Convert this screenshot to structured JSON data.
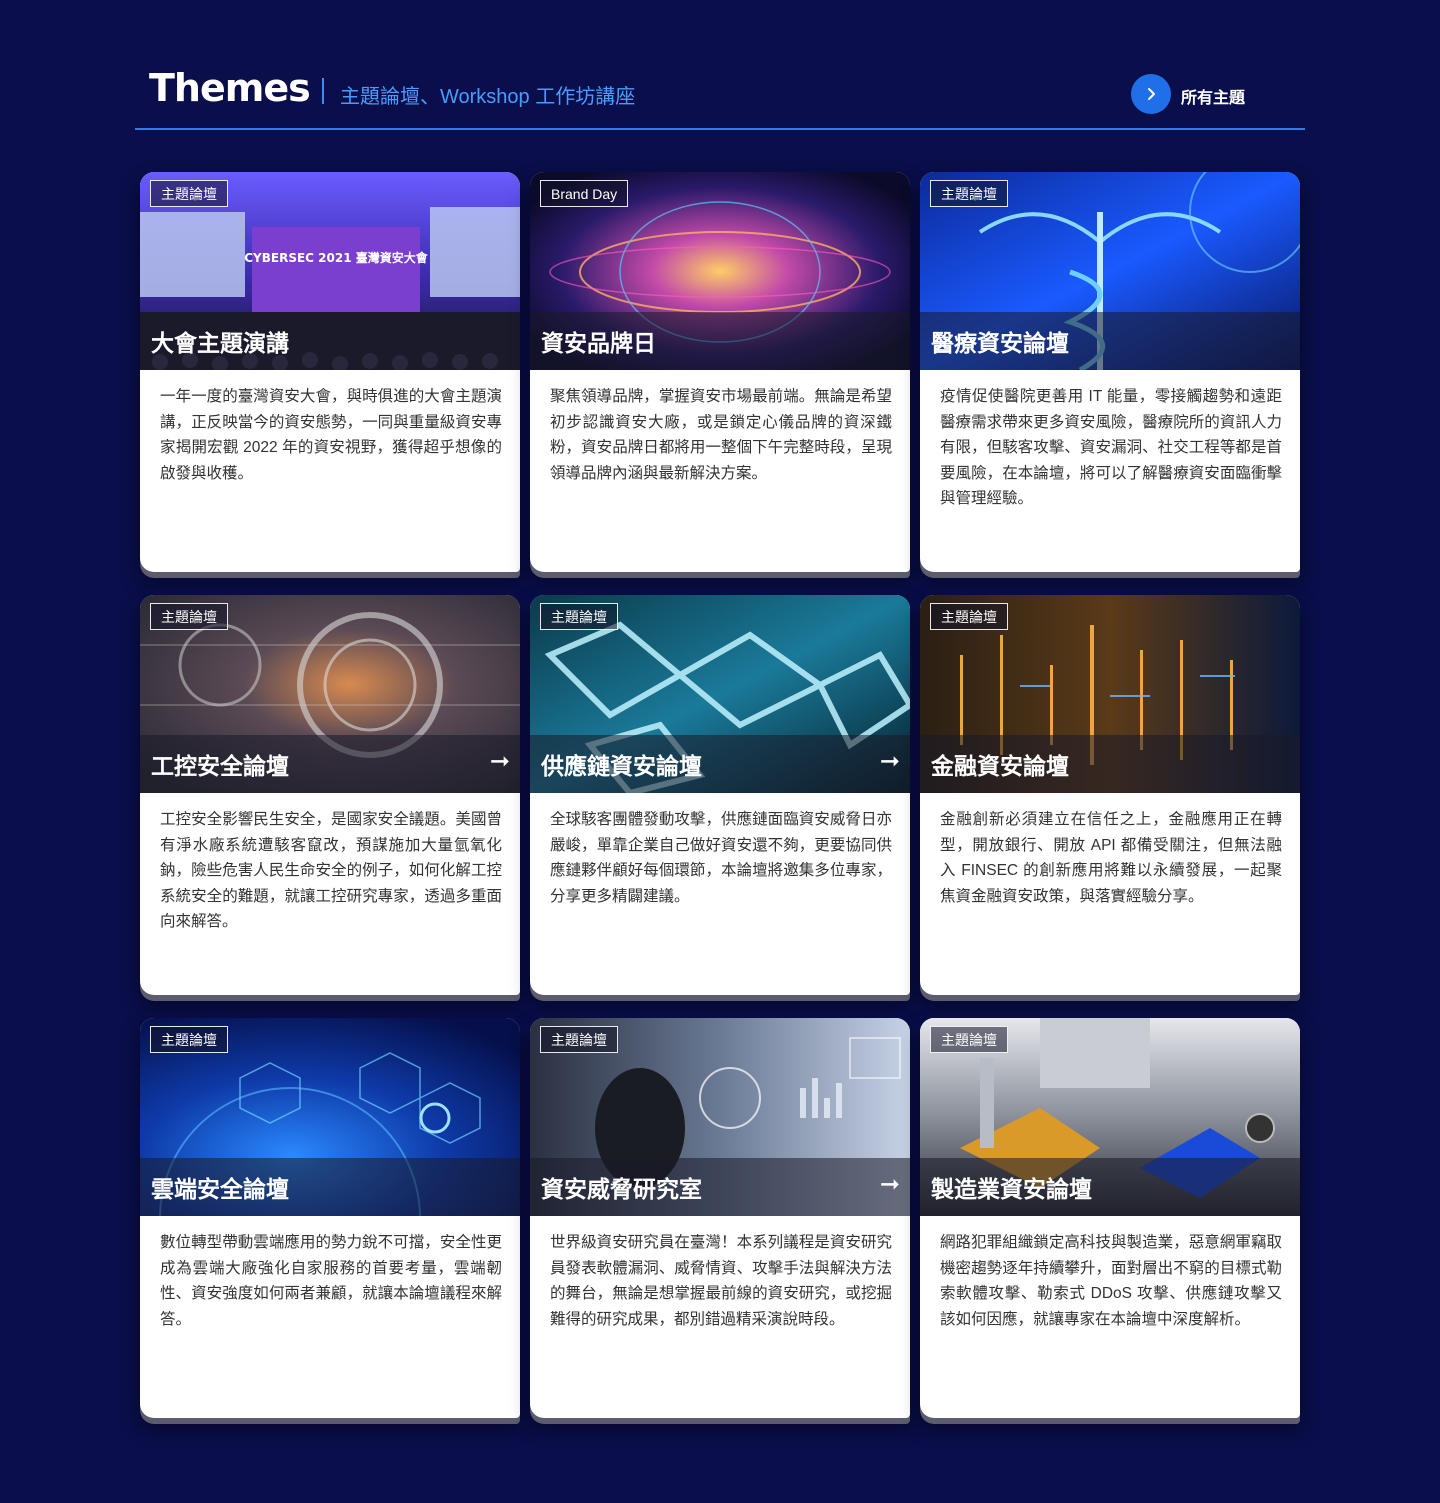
{
  "header": {
    "title": "Themes",
    "subtitle": "主題論壇、Workshop 工作坊講座",
    "all_label": "所有主題"
  },
  "colors": {
    "background": "#0a0e4a",
    "accent": "#1f6fe8",
    "subtitle": "#4a9bff"
  },
  "cards": [
    {
      "tag": "主題論壇",
      "name": "大會主題演講",
      "arrow": "",
      "image_text": "CYBERSEC 2021 臺灣資安大會",
      "desc": "一年一度的臺灣資安大會，與時俱進的大會主題演講，正反映當今的資安態勢，一同與重量級資安專家揭開宏觀 2022 年的資安視野，獲得超乎想像的啟發與收穫。"
    },
    {
      "tag": "Brand Day",
      "name": "資安品牌日",
      "arrow": "",
      "desc": "聚焦領導品牌，掌握資安市場最前端。無論是希望初步認識資安大廠，或是鎖定心儀品牌的資深鐵粉，資安品牌日都將用一整個下午完整時段，呈現領導品牌內涵與最新解決方案。"
    },
    {
      "tag": "主題論壇",
      "name": "醫療資安論壇",
      "arrow": "",
      "desc": "疫情促使醫院更善用 IT 能量，零接觸趨勢和遠距醫療需求帶來更多資安風險，醫療院所的資訊人力有限，但駭客攻擊、資安漏洞、社交工程等都是首要風險，在本論壇，將可以了解醫療資安面臨衝擊與管理經驗。"
    },
    {
      "tag": "主題論壇",
      "name": "工控安全論壇",
      "arrow": "➞",
      "desc": "工控安全影響民生安全，是國家安全議題。美國曾有淨水廠系統遭駭客竄改，預謀施加大量氫氧化鈉，險些危害人民生命安全的例子，如何化解工控系統安全的難題，就讓工控研究專家，透過多重面向來解答。"
    },
    {
      "tag": "主題論壇",
      "name": "供應鏈資安論壇",
      "arrow": "➞",
      "desc": "全球駭客團體發動攻擊，供應鏈面臨資安威脅日亦嚴峻，單靠企業自己做好資安還不夠，更要協同供應鏈夥伴顧好每個環節，本論壇將邀集多位專家，分享更多精闢建議。"
    },
    {
      "tag": "主題論壇",
      "name": "金融資安論壇",
      "arrow": "",
      "desc": "金融創新必須建立在信任之上，金融應用正在轉型，開放銀行、開放 API 都備受關注，但無法融入 FINSEC 的創新應用將難以永續發展，一起聚焦資金融資安政策，與落實經驗分享。"
    },
    {
      "tag": "主題論壇",
      "name": "雲端安全論壇",
      "arrow": "",
      "desc": "數位轉型帶動雲端應用的勢力銳不可擋，安全性更成為雲端大廠強化自家服務的首要考量，雲端韌性、資安強度如何兩者兼顧，就讓本論壇議程來解答。"
    },
    {
      "tag": "主題論壇",
      "name": "資安威脅研究室",
      "arrow": "➞",
      "desc": "世界級資安研究員在臺灣！本系列議程是資安研究員發表軟體漏洞、威脅情資、攻擊手法與解決方法的舞台，無論是想掌握最前線的資安研究，或挖掘難得的研究成果，都別錯過精采演說時段。"
    },
    {
      "tag": "主題論壇",
      "name": "製造業資安論壇",
      "arrow": "",
      "desc": "網路犯罪組織鎖定高科技與製造業，惡意網軍竊取機密趨勢逐年持續攀升，面對層出不窮的目標式勒索軟體攻擊、勒索式 DDoS 攻擊、供應鏈攻擊又該如何因應，就讓專家在本論壇中深度解析。"
    }
  ]
}
